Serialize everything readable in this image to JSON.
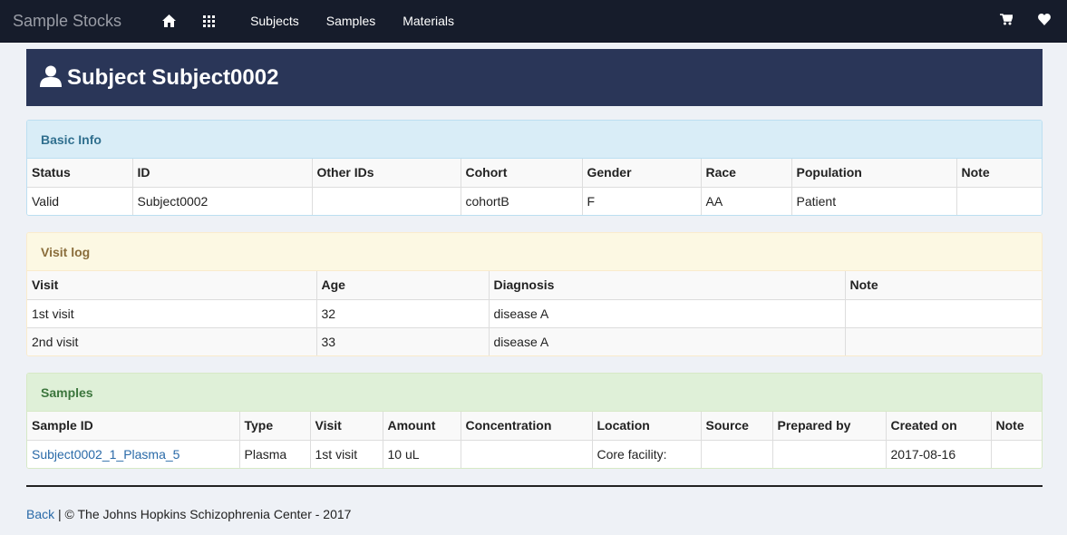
{
  "navbar": {
    "brand": "Sample Stocks",
    "links": [
      "Subjects",
      "Samples",
      "Materials"
    ],
    "icons": [
      "home-icon",
      "grid-icon",
      "cart-icon",
      "heart-icon"
    ]
  },
  "header": {
    "title": "Subject Subject0002",
    "icon": "user-icon"
  },
  "basic_info": {
    "title": "Basic Info",
    "columns": [
      "Status",
      "ID",
      "Other IDs",
      "Cohort",
      "Gender",
      "Race",
      "Population",
      "Note"
    ],
    "rows": [
      [
        "Valid",
        "Subject0002",
        "",
        "cohortB",
        "F",
        "AA",
        "Patient",
        ""
      ]
    ]
  },
  "visit_log": {
    "title": "Visit log",
    "columns": [
      "Visit",
      "Age",
      "Diagnosis",
      "Note"
    ],
    "rows": [
      [
        "1st visit",
        "32",
        "disease A",
        ""
      ],
      [
        "2nd visit",
        "33",
        "disease A",
        ""
      ]
    ]
  },
  "samples": {
    "title": "Samples",
    "columns": [
      "Sample ID",
      "Type",
      "Visit",
      "Amount",
      "Concentration",
      "Location",
      "Source",
      "Prepared by",
      "Created on",
      "Note"
    ],
    "rows": [
      [
        "Subject0002_1_Plasma_5",
        "Plasma",
        "1st visit",
        "10 uL",
        "",
        "Core facility:",
        "",
        "",
        "2017-08-16",
        ""
      ]
    ]
  },
  "footer": {
    "back_label": "Back",
    "text": " | © The Johns Hopkins Schizophrenia Center - 2017"
  }
}
